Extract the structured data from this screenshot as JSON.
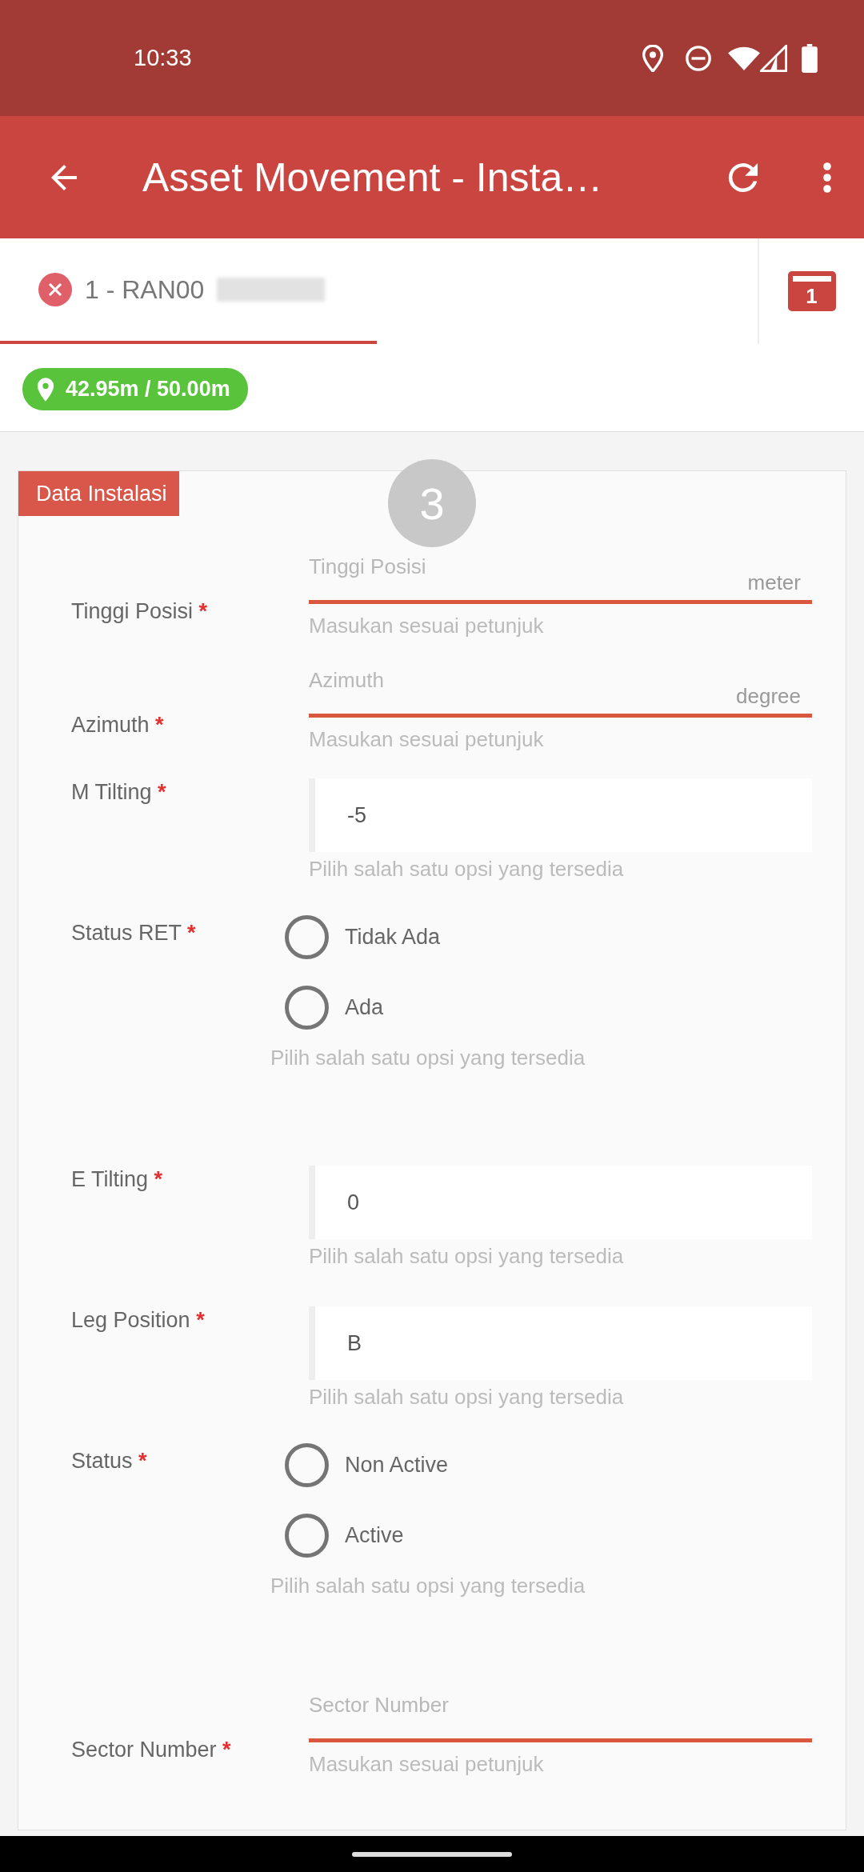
{
  "status_bar": {
    "time": "10:33"
  },
  "app_bar": {
    "title": "Asset Movement - Insta…"
  },
  "tabs": [
    {
      "label": "1 - RAN00",
      "selected": true
    }
  ],
  "calendar_badge": "1",
  "distance_chip": "42.95m / 50.00m",
  "section": {
    "title": "Data Instalasi",
    "step": "3"
  },
  "fields": [
    {
      "kind": "text",
      "label": "Tinggi Posisi",
      "required_mark": "*",
      "placeholder": "Tinggi Posisi",
      "unit": "meter",
      "helper": "Masukan sesuai petunjuk"
    },
    {
      "kind": "text",
      "label": "Azimuth",
      "required_mark": "*",
      "placeholder": "Azimuth",
      "unit": "degree",
      "helper": "Masukan sesuai petunjuk"
    },
    {
      "kind": "select",
      "label": "M Tilting",
      "required_mark": "*",
      "value": "-5",
      "helper": "Pilih salah satu opsi yang tersedia"
    },
    {
      "kind": "radio",
      "label": "Status RET",
      "required_mark": "*",
      "options": [
        {
          "label": "Tidak Ada",
          "selected": false
        },
        {
          "label": "Ada",
          "selected": false
        }
      ],
      "helper": "Pilih salah satu opsi yang tersedia"
    },
    {
      "kind": "select",
      "label": "E Tilting",
      "required_mark": "*",
      "value": "0",
      "helper": "Pilih salah satu opsi yang tersedia"
    },
    {
      "kind": "select",
      "label": "Leg Position",
      "required_mark": "*",
      "value": "B",
      "helper": "Pilih salah satu opsi yang tersedia"
    },
    {
      "kind": "radio",
      "label": "Status",
      "required_mark": "*",
      "options": [
        {
          "label": "Non Active",
          "selected": false
        },
        {
          "label": "Active",
          "selected": false
        }
      ],
      "helper": "Pilih salah satu opsi yang tersedia"
    },
    {
      "kind": "text",
      "label": "Sector Number",
      "required_mark": "*",
      "placeholder": "Sector Number",
      "helper": "Masukan sesuai petunjuk"
    }
  ]
}
